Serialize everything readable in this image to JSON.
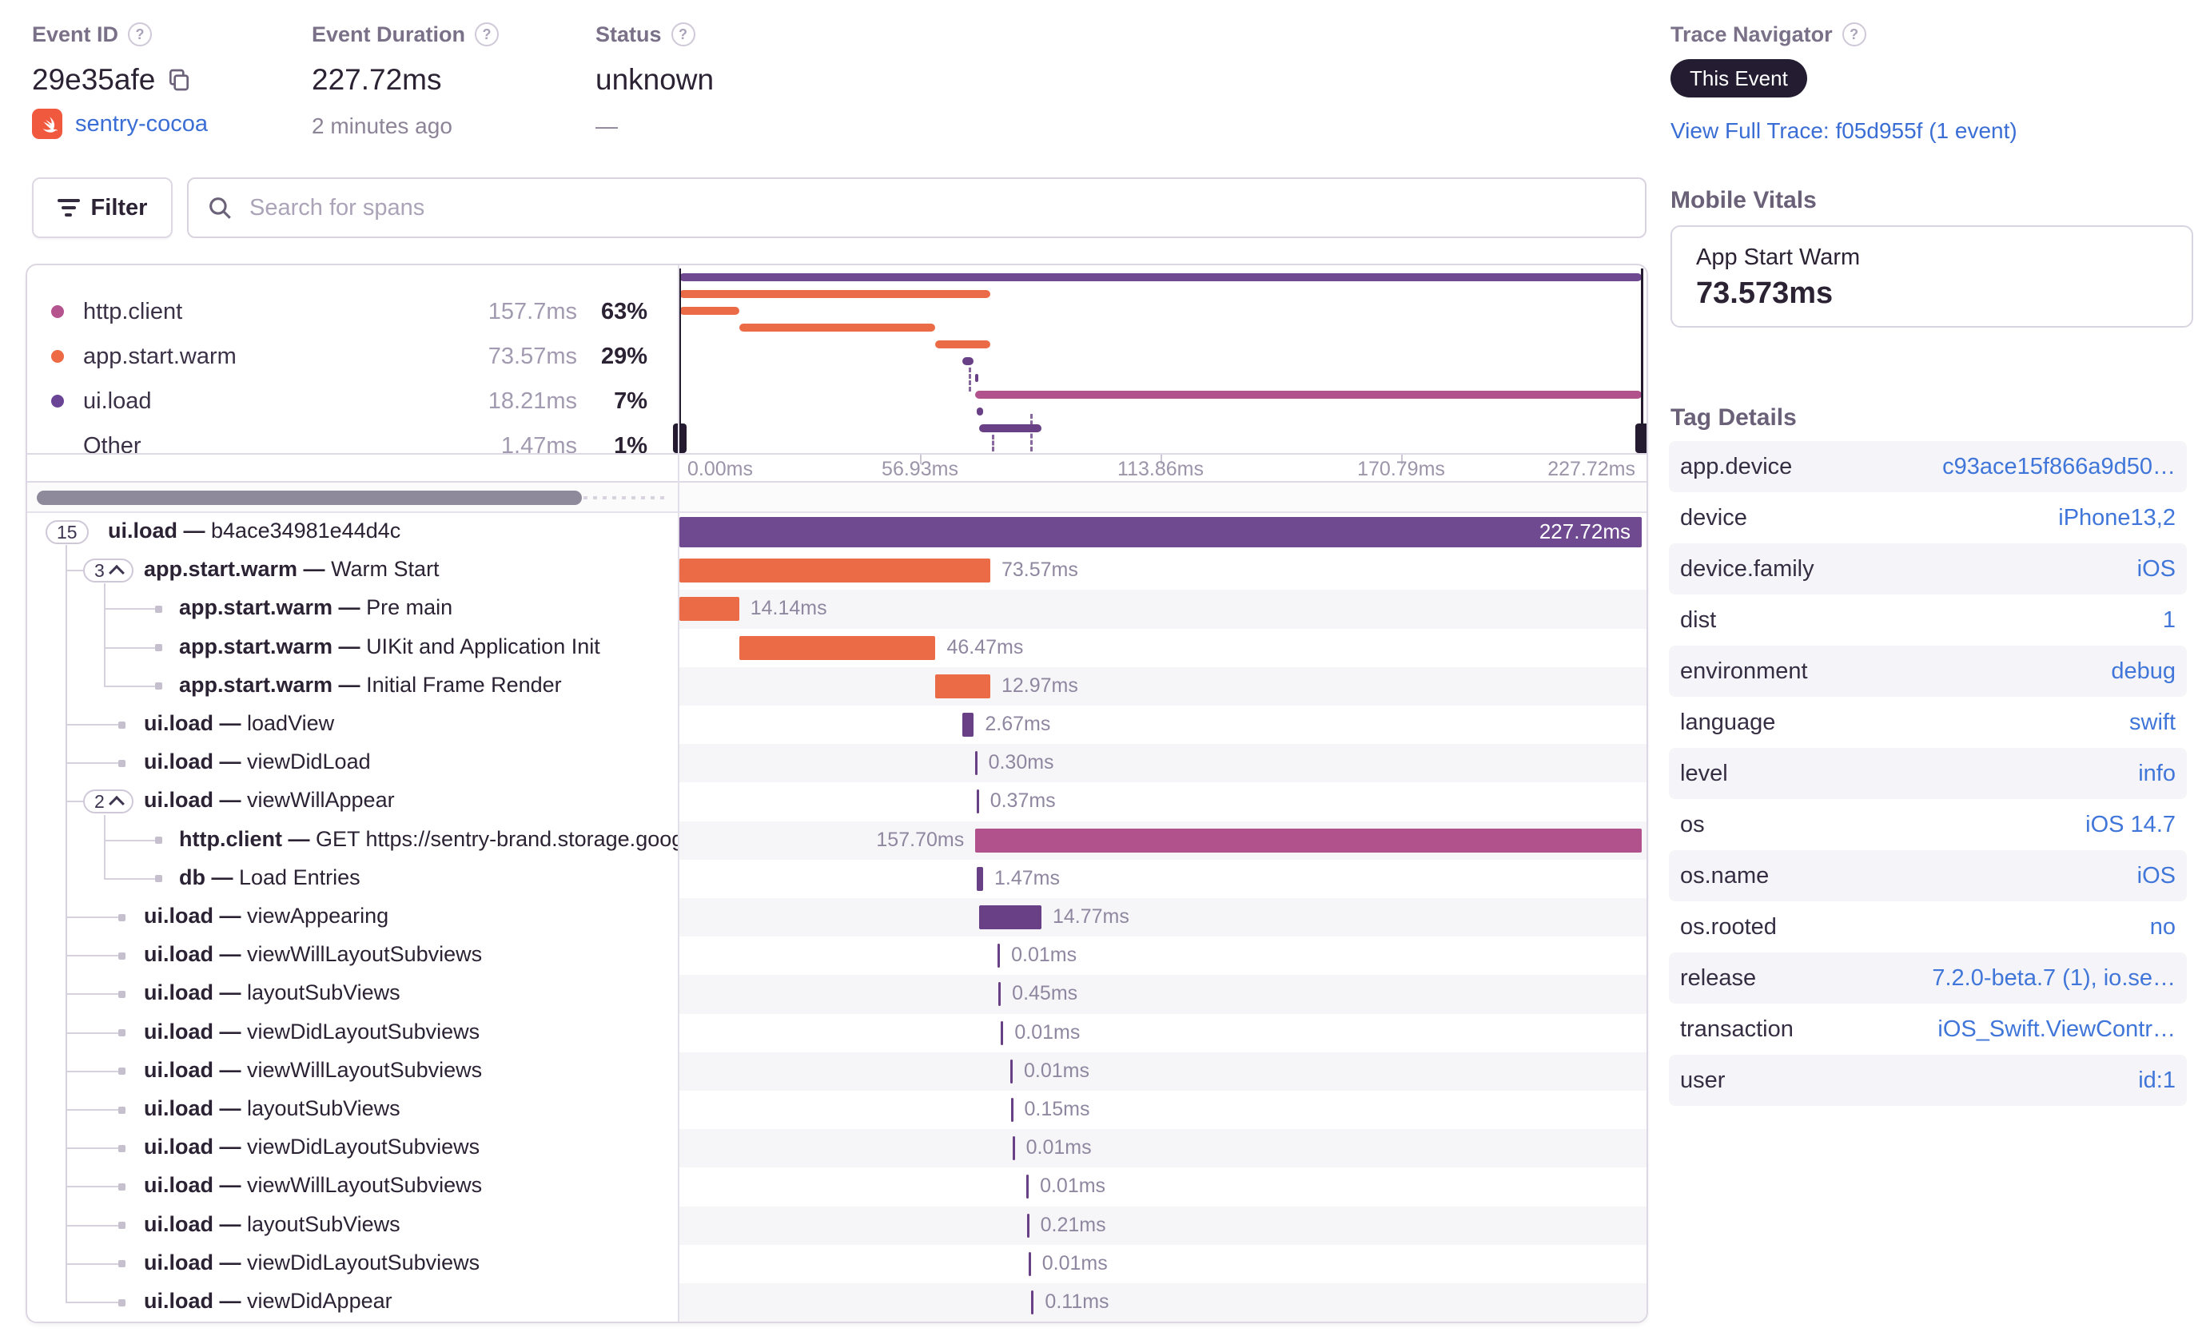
{
  "header": {
    "event_id": {
      "label": "Event ID",
      "value": "29e35afe",
      "project": "sentry-cocoa"
    },
    "event_duration": {
      "label": "Event Duration",
      "value": "227.72ms",
      "relative": "2 minutes ago"
    },
    "status": {
      "label": "Status",
      "value": "unknown",
      "sub": "—"
    },
    "trace_navigator": {
      "label": "Trace Navigator",
      "badge": "This Event",
      "link": "View Full Trace: f05d955f (1 event)"
    }
  },
  "toolbar": {
    "filter": "Filter",
    "search_placeholder": "Search for spans"
  },
  "breakdown": {
    "rows": [
      {
        "name": "http.client",
        "duration": "157.7ms",
        "pct": "63%",
        "color": "#b4538d"
      },
      {
        "name": "app.start.warm",
        "duration": "73.57ms",
        "pct": "29%",
        "color": "#ee6a45"
      },
      {
        "name": "ui.load",
        "duration": "18.21ms",
        "pct": "7%",
        "color": "#6a4596"
      },
      {
        "name": "Other",
        "duration": "1.47ms",
        "pct": "1%",
        "color": ""
      }
    ]
  },
  "minimap": {
    "axis_ticks": [
      "0.00ms",
      "56.93ms",
      "113.86ms",
      "170.79ms",
      "227.72ms"
    ],
    "total_ms": 227.72
  },
  "colors": {
    "root": "#6f4a90",
    "purple": "#693f85",
    "orange": "#ec6b47",
    "magenta": "#b1528c"
  },
  "spans": [
    {
      "op": "ui.load",
      "desc": "b4ace34981e44d4c",
      "duration": "227.72ms",
      "start": 0,
      "ms": 227.72,
      "color": "root",
      "level": 0,
      "badge": "15",
      "chevron": false,
      "label_pos": "inside"
    },
    {
      "op": "app.start.warm",
      "desc": "Warm Start",
      "duration": "73.57ms",
      "start": 0,
      "ms": 73.57,
      "color": "orange",
      "level": 1,
      "badge": "3",
      "chevron": true,
      "label_pos": "right"
    },
    {
      "op": "app.start.warm",
      "desc": "Pre main",
      "duration": "14.14ms",
      "start": 0,
      "ms": 14.14,
      "color": "orange",
      "level": 2,
      "label_pos": "right"
    },
    {
      "op": "app.start.warm",
      "desc": "UIKit and Application Init",
      "duration": "46.47ms",
      "start": 14.14,
      "ms": 46.47,
      "color": "orange",
      "level": 2,
      "label_pos": "right"
    },
    {
      "op": "app.start.warm",
      "desc": "Initial Frame Render",
      "duration": "12.97ms",
      "start": 60.6,
      "ms": 12.97,
      "color": "orange",
      "level": 2,
      "label_pos": "right"
    },
    {
      "op": "ui.load",
      "desc": "loadView",
      "duration": "2.67ms",
      "start": 67.0,
      "ms": 2.67,
      "color": "purple",
      "level": 1,
      "label_pos": "right"
    },
    {
      "op": "ui.load",
      "desc": "viewDidLoad",
      "duration": "0.30ms",
      "start": 69.9,
      "ms": 0.3,
      "color": "purple",
      "level": 1,
      "label_pos": "right"
    },
    {
      "op": "ui.load",
      "desc": "viewWillAppear",
      "duration": "0.37ms",
      "start": 70.3,
      "ms": 0.37,
      "color": "purple",
      "level": 1,
      "badge": "2",
      "chevron": true,
      "label_pos": "right"
    },
    {
      "op": "http.client",
      "desc": "GET https://sentry-brand.storage.googlea",
      "duration": "157.70ms",
      "start": 70.02,
      "ms": 157.7,
      "color": "magenta",
      "level": 2,
      "label_pos": "left"
    },
    {
      "op": "db",
      "desc": "Load Entries",
      "duration": "1.47ms",
      "start": 70.4,
      "ms": 1.47,
      "color": "purple",
      "level": 2,
      "label_pos": "right"
    },
    {
      "op": "ui.load",
      "desc": "viewAppearing",
      "duration": "14.77ms",
      "start": 70.9,
      "ms": 14.77,
      "color": "purple",
      "level": 1,
      "label_pos": "right"
    },
    {
      "op": "ui.load",
      "desc": "viewWillLayoutSubviews",
      "duration": "0.01ms",
      "start": 75.3,
      "ms": 0.01,
      "color": "purple",
      "level": 1,
      "label_pos": "right"
    },
    {
      "op": "ui.load",
      "desc": "layoutSubViews",
      "duration": "0.45ms",
      "start": 75.5,
      "ms": 0.45,
      "color": "purple",
      "level": 1,
      "label_pos": "right"
    },
    {
      "op": "ui.load",
      "desc": "viewDidLayoutSubviews",
      "duration": "0.01ms",
      "start": 76.1,
      "ms": 0.01,
      "color": "purple",
      "level": 1,
      "label_pos": "right"
    },
    {
      "op": "ui.load",
      "desc": "viewWillLayoutSubviews",
      "duration": "0.01ms",
      "start": 78.3,
      "ms": 0.01,
      "color": "purple",
      "level": 1,
      "label_pos": "right"
    },
    {
      "op": "ui.load",
      "desc": "layoutSubViews",
      "duration": "0.15ms",
      "start": 78.4,
      "ms": 0.15,
      "color": "purple",
      "level": 1,
      "label_pos": "right"
    },
    {
      "op": "ui.load",
      "desc": "viewDidLayoutSubviews",
      "duration": "0.01ms",
      "start": 78.8,
      "ms": 0.01,
      "color": "purple",
      "level": 1,
      "label_pos": "right"
    },
    {
      "op": "ui.load",
      "desc": "viewWillLayoutSubviews",
      "duration": "0.01ms",
      "start": 82.1,
      "ms": 0.01,
      "color": "purple",
      "level": 1,
      "label_pos": "right"
    },
    {
      "op": "ui.load",
      "desc": "layoutSubViews",
      "duration": "0.21ms",
      "start": 82.2,
      "ms": 0.21,
      "color": "purple",
      "level": 1,
      "label_pos": "right"
    },
    {
      "op": "ui.load",
      "desc": "viewDidLayoutSubviews",
      "duration": "0.01ms",
      "start": 82.6,
      "ms": 0.01,
      "color": "purple",
      "level": 1,
      "label_pos": "right"
    },
    {
      "op": "ui.load",
      "desc": "viewDidAppear",
      "duration": "0.11ms",
      "start": 83.3,
      "ms": 0.11,
      "color": "purple",
      "level": 1,
      "label_pos": "right"
    }
  ],
  "sidebar": {
    "mobile_vitals": {
      "title": "Mobile Vitals",
      "metric_name": "App Start Warm",
      "metric_value": "73.573ms"
    },
    "tag_details": {
      "title": "Tag Details",
      "rows": [
        {
          "key": "app.device",
          "value": "c93ace15f866a9d50…"
        },
        {
          "key": "device",
          "value": "iPhone13,2"
        },
        {
          "key": "device.family",
          "value": "iOS"
        },
        {
          "key": "dist",
          "value": "1"
        },
        {
          "key": "environment",
          "value": "debug"
        },
        {
          "key": "language",
          "value": "swift"
        },
        {
          "key": "level",
          "value": "info"
        },
        {
          "key": "os",
          "value": "iOS 14.7"
        },
        {
          "key": "os.name",
          "value": "iOS"
        },
        {
          "key": "os.rooted",
          "value": "no"
        },
        {
          "key": "release",
          "value": "7.2.0-beta.7 (1), io.se…"
        },
        {
          "key": "transaction",
          "value": "iOS_Swift.ViewContr…"
        },
        {
          "key": "user",
          "value": "id:1"
        }
      ]
    }
  }
}
